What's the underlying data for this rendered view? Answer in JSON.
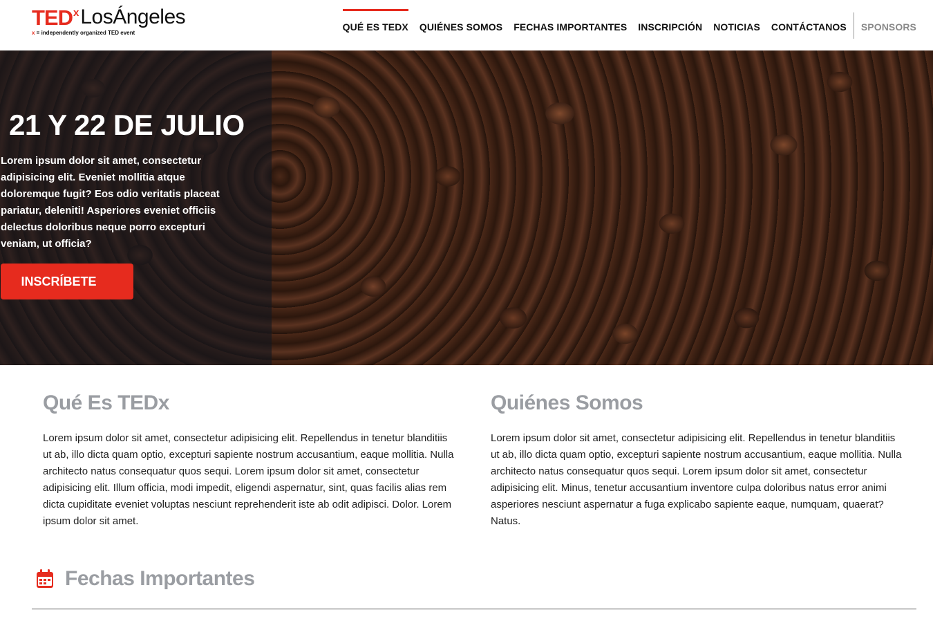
{
  "header": {
    "logo": {
      "ted": "TED",
      "x": "x",
      "city": "LosÁngeles",
      "tagline_x": "x",
      "tagline": " = independently organized TED event"
    },
    "nav": [
      {
        "label": "Qué es TEDx",
        "active": true
      },
      {
        "label": "Quiénes somos",
        "active": false
      },
      {
        "label": "Fechas Importantes",
        "active": false
      },
      {
        "label": "Inscripción",
        "active": false
      },
      {
        "label": "Noticias",
        "active": false
      },
      {
        "label": "Contáctanos",
        "active": false
      }
    ],
    "sponsors_label": "Sponsors"
  },
  "hero": {
    "date": "21 Y 22 DE JULIO",
    "text": "Lorem ipsum dolor sit amet, consectetur adipisicing elit. Eveniet mollitia atque doloremque fugit? Eos odio veritatis placeat pariatur, deleniti! Asperiores eveniet officiis delectus doloribus neque porro excepturi veniam, ut officia?",
    "button_label": "INSCRÍBETE"
  },
  "about": {
    "title": "Qué Es TEDx",
    "body": "Lorem ipsum dolor sit amet, consectetur adipisicing elit. Repellendus in tenetur blanditiis ut ab, illo dicta quam optio, excepturi sapiente nostrum accusantium, eaque mollitia. Nulla architecto natus consequatur quos sequi. Lorem ipsum dolor sit amet, consectetur adipisicing elit. Illum officia, modi impedit, eligendi aspernatur, sint, quas facilis alias rem dicta cupiditate eveniet voluptas nesciunt reprehenderit iste ab odit adipisci. Dolor. Lorem ipsum dolor sit amet."
  },
  "who": {
    "title": "Quiénes Somos",
    "body": "Lorem ipsum dolor sit amet, consectetur adipisicing elit. Repellendus in tenetur blanditiis ut ab, illo dicta quam optio, excepturi sapiente nostrum accusantium, eaque mollitia. Nulla architecto natus consequatur quos sequi. Lorem ipsum dolor sit amet, consectetur adipisicing elit. Minus, tenetur accusantium inventore culpa doloribus natus error animi asperiores nesciunt aspernatur a fuga explicabo sapiente eaque, numquam, quaerat? Natus."
  },
  "dates": {
    "title": "Fechas Importantes",
    "icon": "calendar-icon"
  },
  "colors": {
    "brand_red": "#e62b1e",
    "heading_gray": "#9a9da2"
  }
}
